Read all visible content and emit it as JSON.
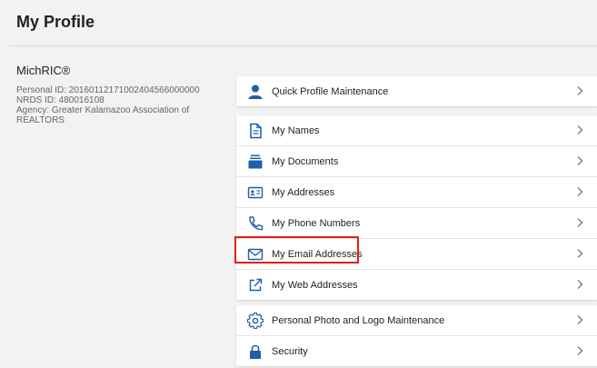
{
  "page": {
    "title": "My Profile"
  },
  "profile": {
    "org": "MichRIC®",
    "personal_id": "Personal ID: 20160112171002404566000000",
    "nrds_id": "NRDS ID: 480016108",
    "agency": "Agency: Greater Kalamazoo Association of REALTORS"
  },
  "menu": {
    "quick": {
      "label": "Quick Profile Maintenance",
      "icon": "user-icon"
    },
    "main": [
      {
        "label": "My Names",
        "icon": "document-icon"
      },
      {
        "label": "My Documents",
        "icon": "tray-icon"
      },
      {
        "label": "My Addresses",
        "icon": "id-card-icon"
      },
      {
        "label": "My Phone Numbers",
        "icon": "phone-icon"
      },
      {
        "label": "My Email Addresses",
        "icon": "envelope-icon"
      },
      {
        "label": "My Web Addresses",
        "icon": "external-link-icon"
      }
    ],
    "other": [
      {
        "label": "Personal Photo and Logo Maintenance",
        "icon": "gear-icon"
      },
      {
        "label": "Security",
        "icon": "lock-icon"
      }
    ]
  },
  "colors": {
    "accent": "#1d5fa8",
    "highlight": "#e0201b"
  }
}
